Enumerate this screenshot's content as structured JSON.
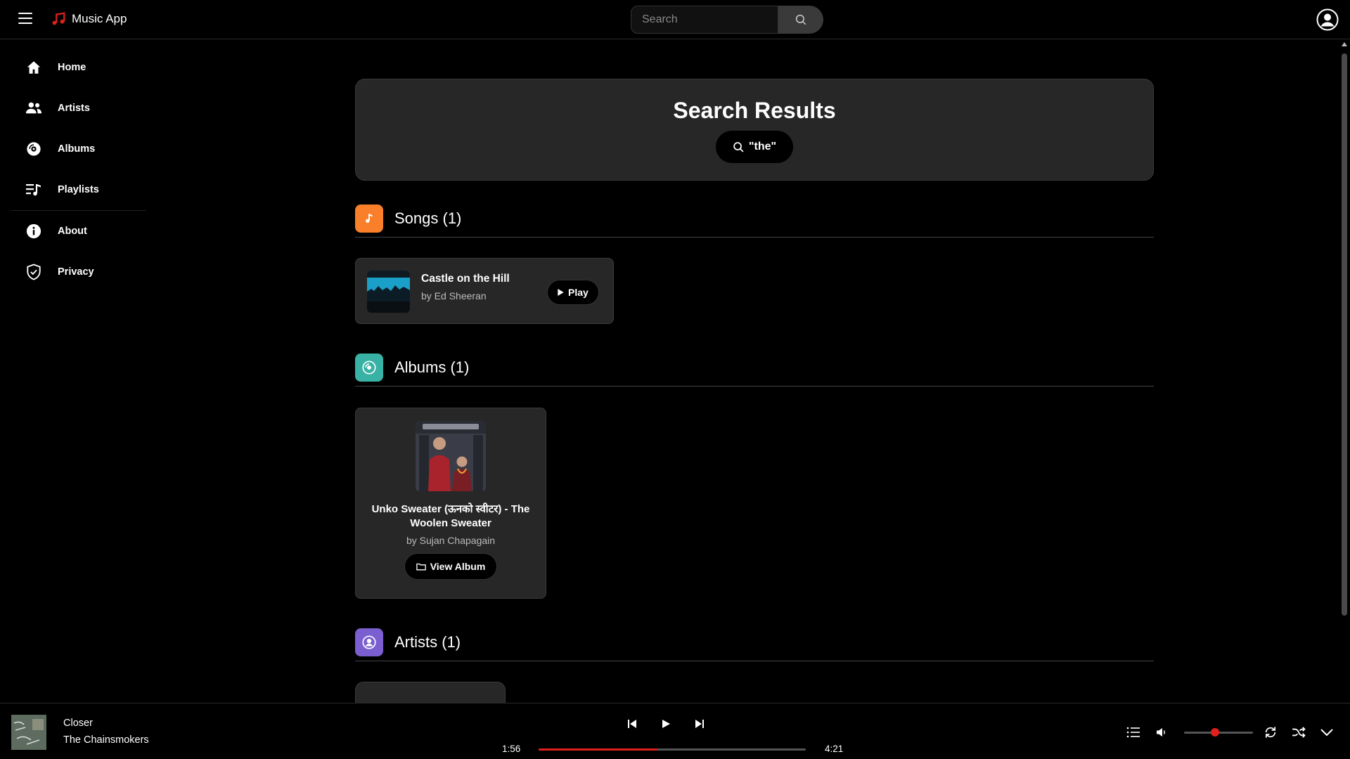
{
  "app": {
    "name": "Music App"
  },
  "search": {
    "placeholder": "Search",
    "value": ""
  },
  "sidebar": {
    "items": [
      {
        "label": "Home"
      },
      {
        "label": "Artists"
      },
      {
        "label": "Albums"
      },
      {
        "label": "Playlists"
      },
      {
        "label": "About"
      },
      {
        "label": "Privacy"
      }
    ]
  },
  "results": {
    "title": "Search Results",
    "query": "\"the\""
  },
  "songs_section": {
    "title": "Songs (1)",
    "items": [
      {
        "title": "Castle on the Hill",
        "artist": "by Ed Sheeran",
        "action": "Play"
      }
    ]
  },
  "albums_section": {
    "title": "Albums (1)",
    "items": [
      {
        "title": "Unko Sweater (ऊनको स्वीटर) - The Woolen Sweater",
        "artist": "by Sujan Chapagain",
        "action": "View Album"
      }
    ]
  },
  "artists_section": {
    "title": "Artists (1)"
  },
  "player": {
    "track_title": "Closer",
    "track_artist": "The Chainsmokers",
    "elapsed": "1:56",
    "duration": "4:21",
    "progress_fraction": 0.444,
    "volume_fraction": 0.45
  },
  "colors": {
    "accent": "#e0201c",
    "songs_badge": "#f97f2a",
    "albums_badge": "#38b2a4",
    "artists_badge": "#7b5fd1",
    "card_bg": "#272727"
  }
}
